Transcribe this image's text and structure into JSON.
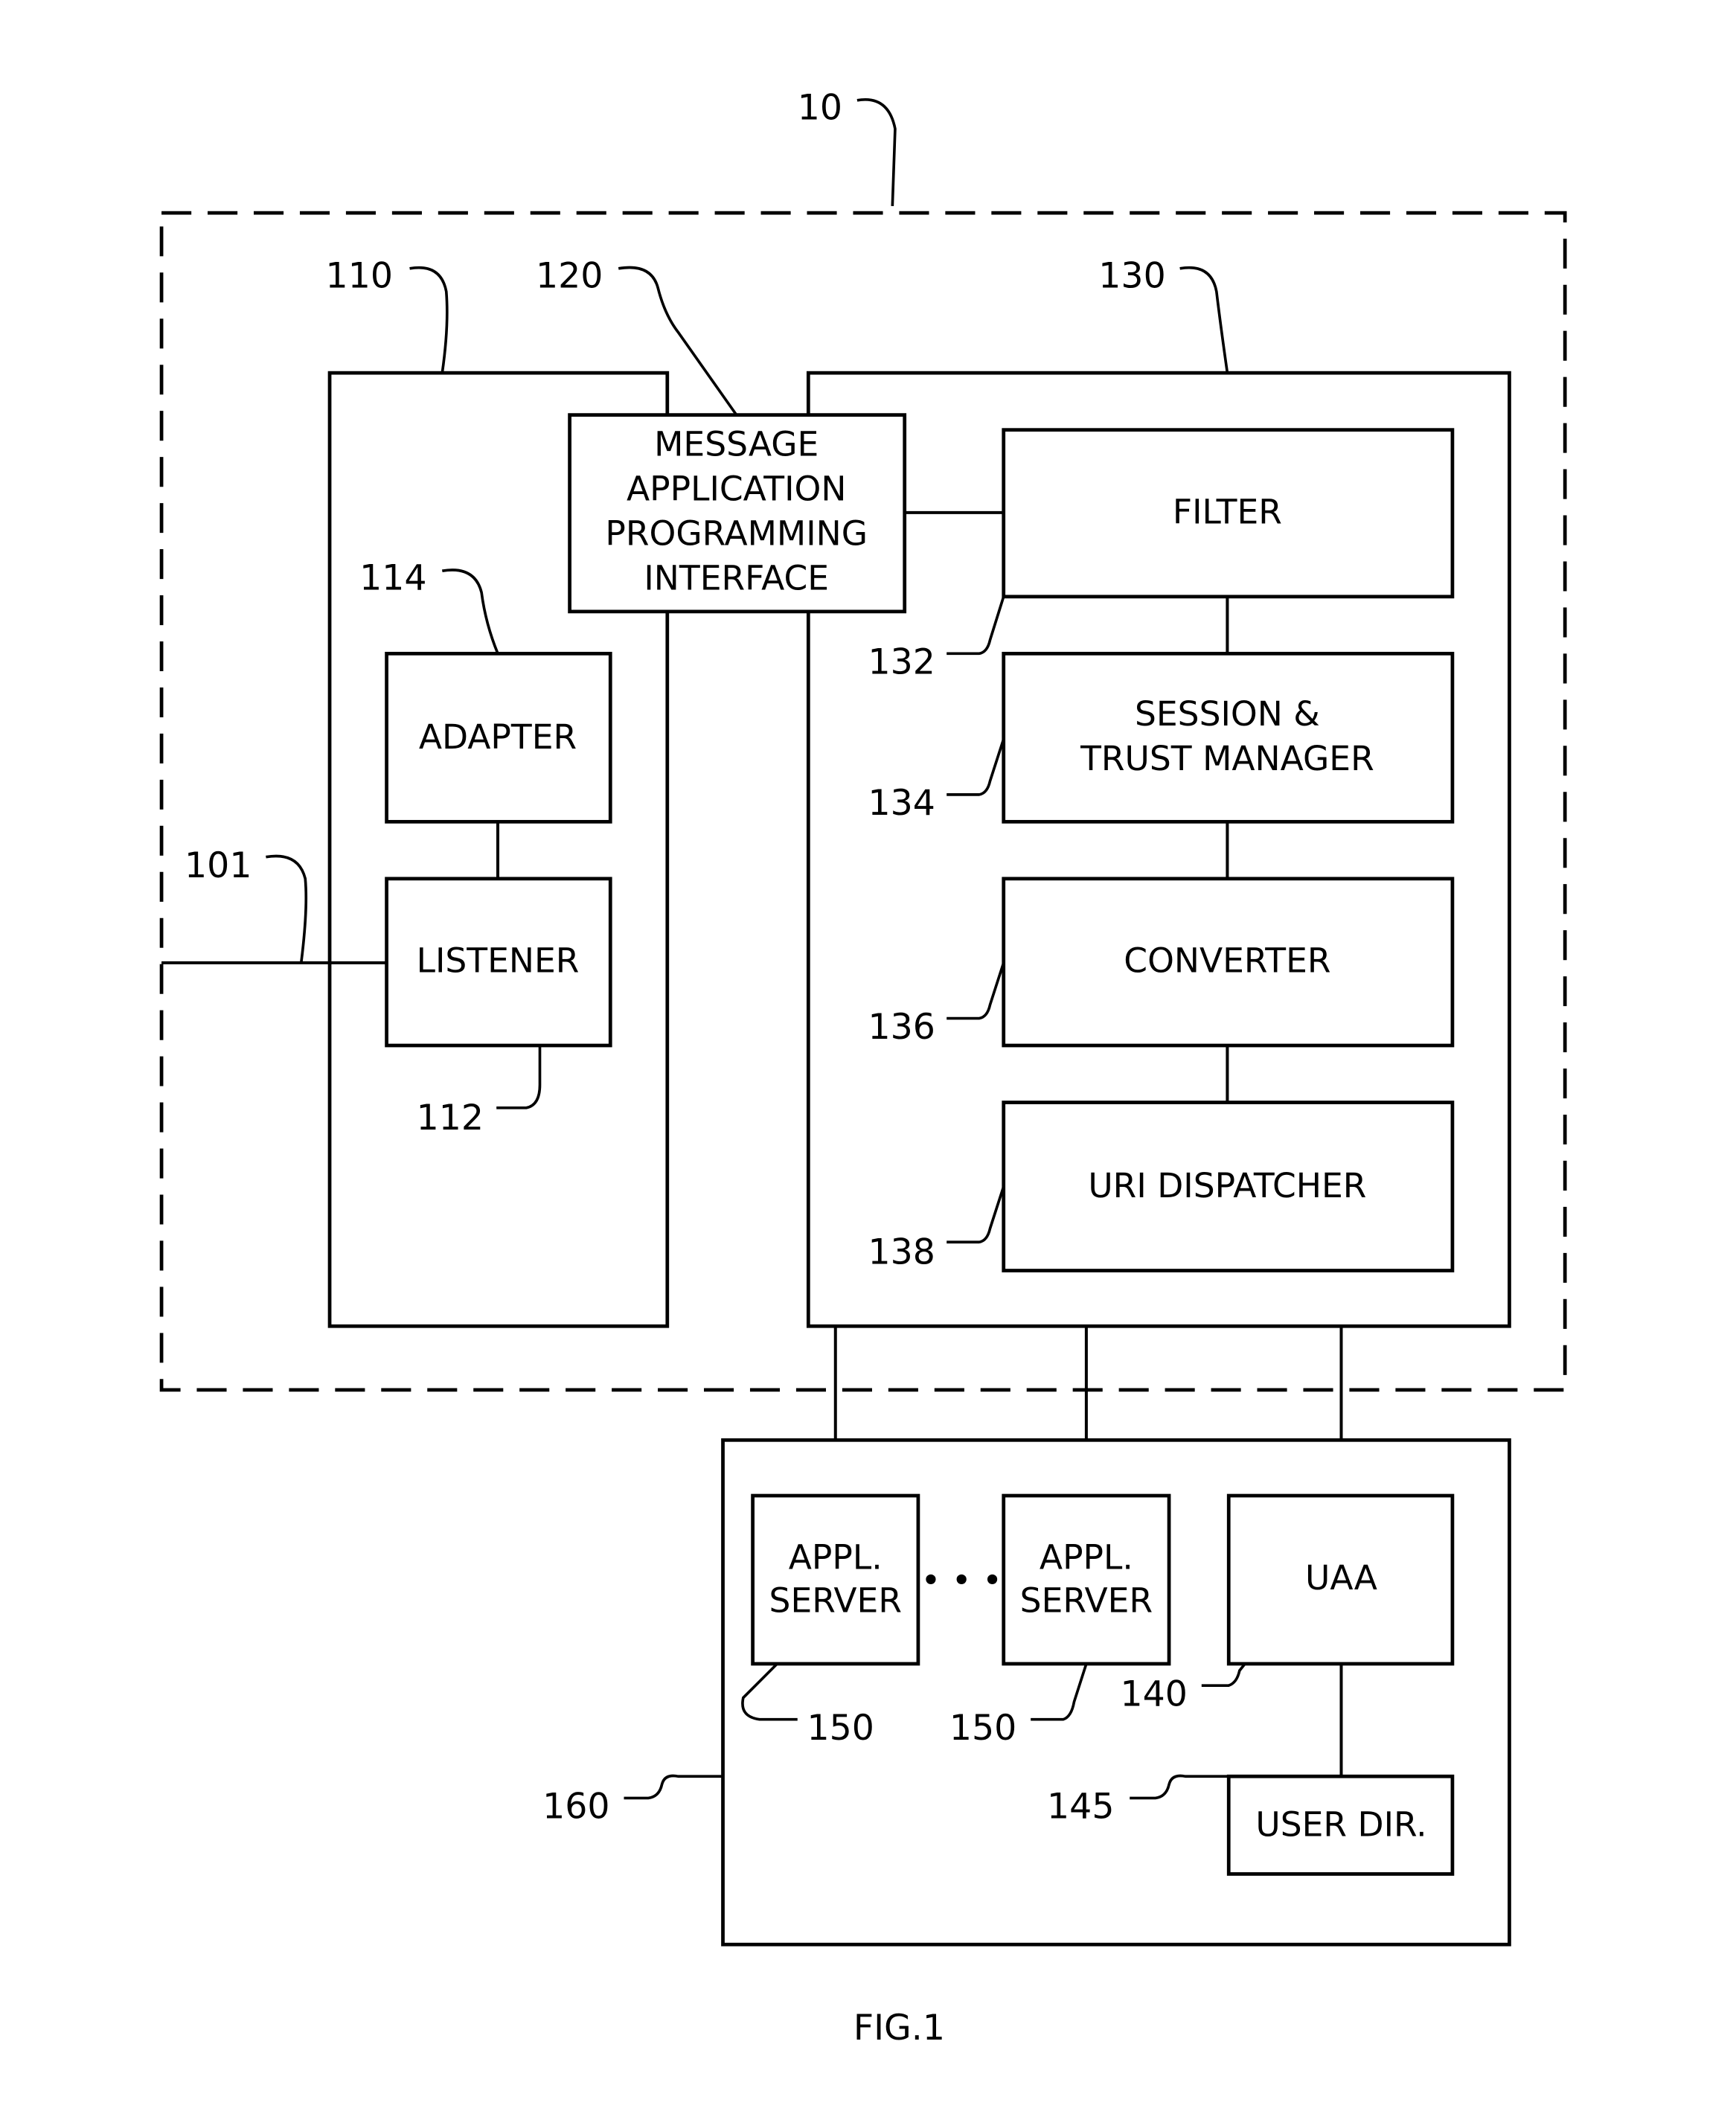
{
  "figure": {
    "caption": "FIG.1",
    "system_ref": "10"
  },
  "components": {
    "listener_module": {
      "ref": "110"
    },
    "adapter": {
      "ref": "114",
      "label": "ADAPTER"
    },
    "listener": {
      "ref": "112",
      "label": "LISTENER"
    },
    "input_line": {
      "ref": "101"
    },
    "message_api": {
      "ref": "120",
      "lines": [
        "MESSAGE",
        "APPLICATION",
        "PROGRAMMING",
        "INTERFACE"
      ]
    },
    "processing_module": {
      "ref": "130"
    },
    "filter": {
      "ref": "132",
      "label": "FILTER"
    },
    "session_trust_manager": {
      "ref": "134",
      "lines": [
        "SESSION &",
        "TRUST MANAGER"
      ]
    },
    "converter": {
      "ref": "136",
      "label": "CONVERTER"
    },
    "uri_dispatcher": {
      "ref": "138",
      "label": "URI DISPATCHER"
    },
    "backend": {
      "ref": "160"
    },
    "appl_server_1": {
      "ref": "150",
      "lines": [
        "APPL.",
        "SERVER"
      ]
    },
    "appl_server_2": {
      "ref": "150",
      "lines": [
        "APPL.",
        "SERVER"
      ]
    },
    "ellipsis": "• • •",
    "uaa": {
      "ref": "140",
      "label": "UAA"
    },
    "user_directory": {
      "ref": "145",
      "label": "USER DIR."
    }
  }
}
